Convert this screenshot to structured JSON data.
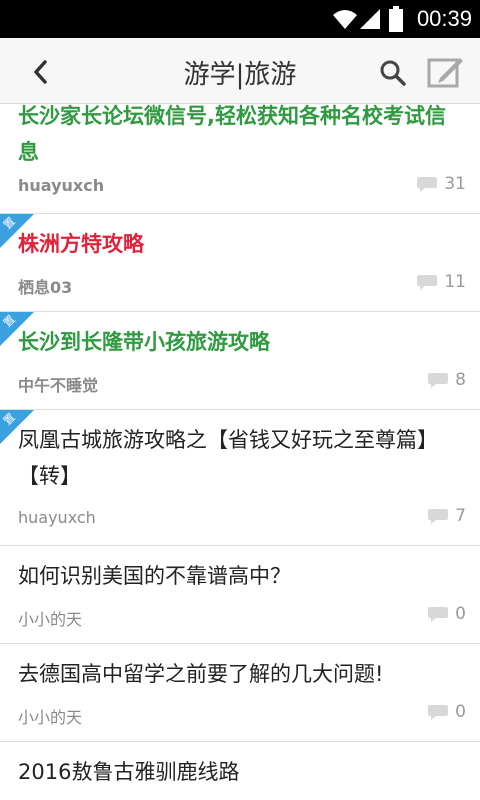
{
  "status": {
    "time": "00:39"
  },
  "header": {
    "title": "游学|旅游"
  },
  "topics": [
    {
      "title": "长沙家长论坛微信号,轻松获知各种名校考试信息",
      "author": "huayuxch",
      "replies": "31",
      "style": "green"
    },
    {
      "title": "株洲方特攻略",
      "author": "栖息03",
      "replies": "11",
      "style": "red"
    },
    {
      "title": "长沙到长隆带小孩旅游攻略",
      "author": "中午不睡觉",
      "replies": "8",
      "style": "green"
    },
    {
      "title": "凤凰古城旅游攻略之【省钱又好玩之至尊篇】【转】",
      "author": "huayuxch",
      "replies": "7",
      "style": "normal"
    },
    {
      "title": "如何识别美国的不靠谱高中？",
      "author": "小小的天",
      "replies": "0",
      "style": "normal"
    },
    {
      "title": "去德国高中留学之前要了解的几大问题!",
      "author": "小小的天",
      "replies": "0",
      "style": "normal"
    },
    {
      "title": "2016敖鲁古雅驯鹿线路",
      "author": "",
      "replies": "",
      "style": "normal"
    }
  ],
  "badge_label": "置",
  "colors": {
    "green": "#2f9a3f",
    "red": "#e0233a",
    "badge": "#3aa0e0"
  }
}
